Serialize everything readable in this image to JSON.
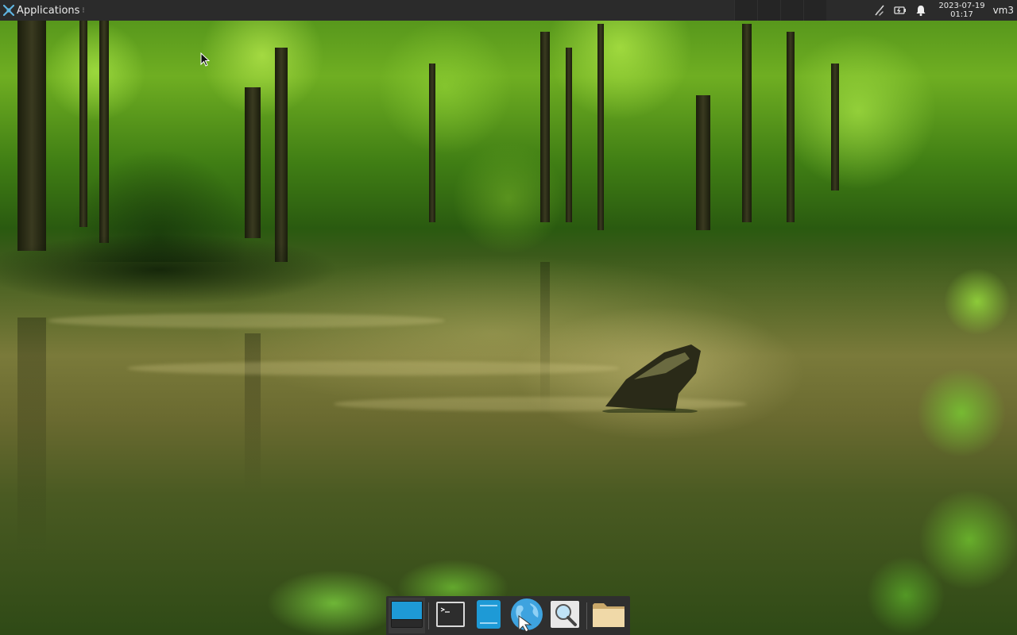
{
  "top_panel": {
    "applications_label": "Applications",
    "date": "2023-07-19",
    "time": "01:17",
    "user": "vm3",
    "tray_icons": [
      "network-disconnected-icon",
      "battery-charging-icon",
      "notification-bell-icon"
    ]
  },
  "dock": {
    "items": [
      {
        "name": "show-desktop",
        "icon": "desktop-icon"
      },
      {
        "name": "terminal",
        "icon": "terminal-icon"
      },
      {
        "name": "file-manager-pane",
        "icon": "file-manager-icon"
      },
      {
        "name": "web-browser",
        "icon": "globe-icon"
      },
      {
        "name": "app-finder",
        "icon": "magnifier-icon"
      },
      {
        "name": "home-folder",
        "icon": "folder-icon"
      }
    ]
  },
  "colors": {
    "panel_bg": "#2b2b2b",
    "dock_bg": "#2f2f2f",
    "accent_blue": "#1e9ad6"
  }
}
